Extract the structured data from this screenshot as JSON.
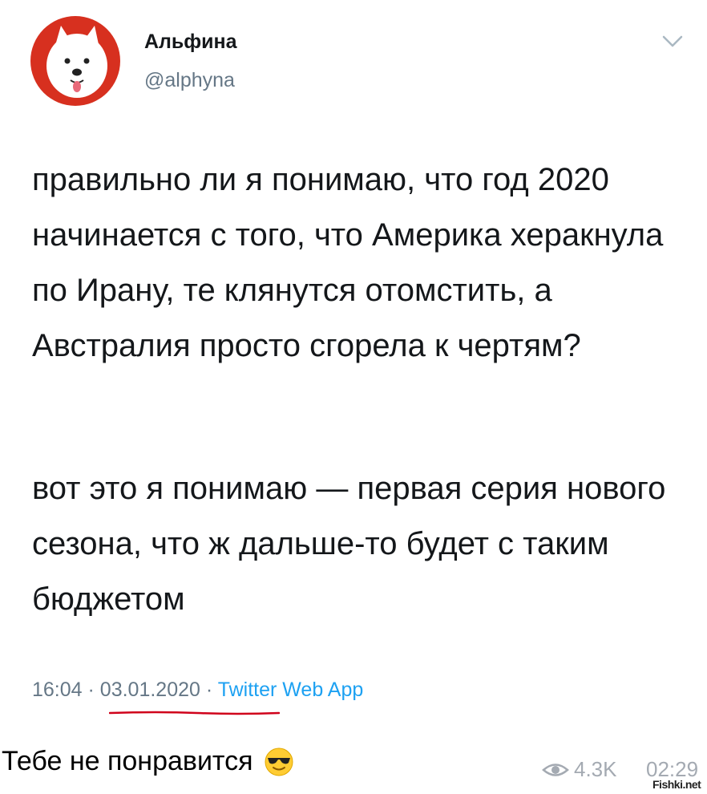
{
  "tweet": {
    "author": {
      "display_name": "Альфина",
      "handle": "@alphyna",
      "avatar": "white-dog-on-red-avatar"
    },
    "menu_icon": "chevron-down-icon",
    "paragraphs": [
      "правильно ли я понимаю, что год 2020 начинается с того, что Америка хераknула по Ирану, те клянутся отомстить, а Австралия просто сгорела к чертям?",
      "вот это я понимаю — первая серия нового сезона, что ж дальше-то будет с таким бюджетом"
    ],
    "time": "16:04",
    "separator": "·",
    "date": "03.01.2020",
    "source": "Twitter Web App",
    "underline_color": "#d0021b"
  },
  "post": {
    "caption": "Тебе не понравится",
    "emoji": "sunglasses-emoji",
    "views_icon": "eye-icon",
    "views": "4.3K",
    "time": "02:29",
    "watermark": "Fishki.net"
  }
}
